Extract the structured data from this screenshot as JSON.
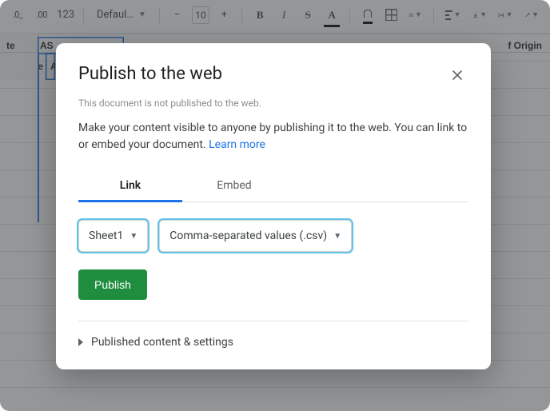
{
  "toolbar": {
    "decimal_dec": ".0_",
    "decimal_inc": ".00",
    "num_format": "123",
    "font_family": "Defaul…",
    "font_size": "10",
    "minus": "−",
    "plus": "+",
    "bold": "B",
    "italic": "I",
    "strike": "S",
    "text_color_glyph": "A"
  },
  "visible_columns": {
    "left_partial": "te",
    "a": "A",
    "right_partial": "f Origin"
  },
  "row1": {
    "a": "AS"
  },
  "dialog": {
    "title": "Publish to the web",
    "status": "This document is not published to the web.",
    "blurb": "Make your content visible to anyone by publishing it to the web. You can link to or embed your document. ",
    "learn_more": "Learn more",
    "tab_link": "Link",
    "tab_embed": "Embed",
    "sheet_select": "Sheet1",
    "format_select": "Comma-separated values (.csv)",
    "publish_btn": "Publish",
    "expander": "Published content & settings"
  }
}
